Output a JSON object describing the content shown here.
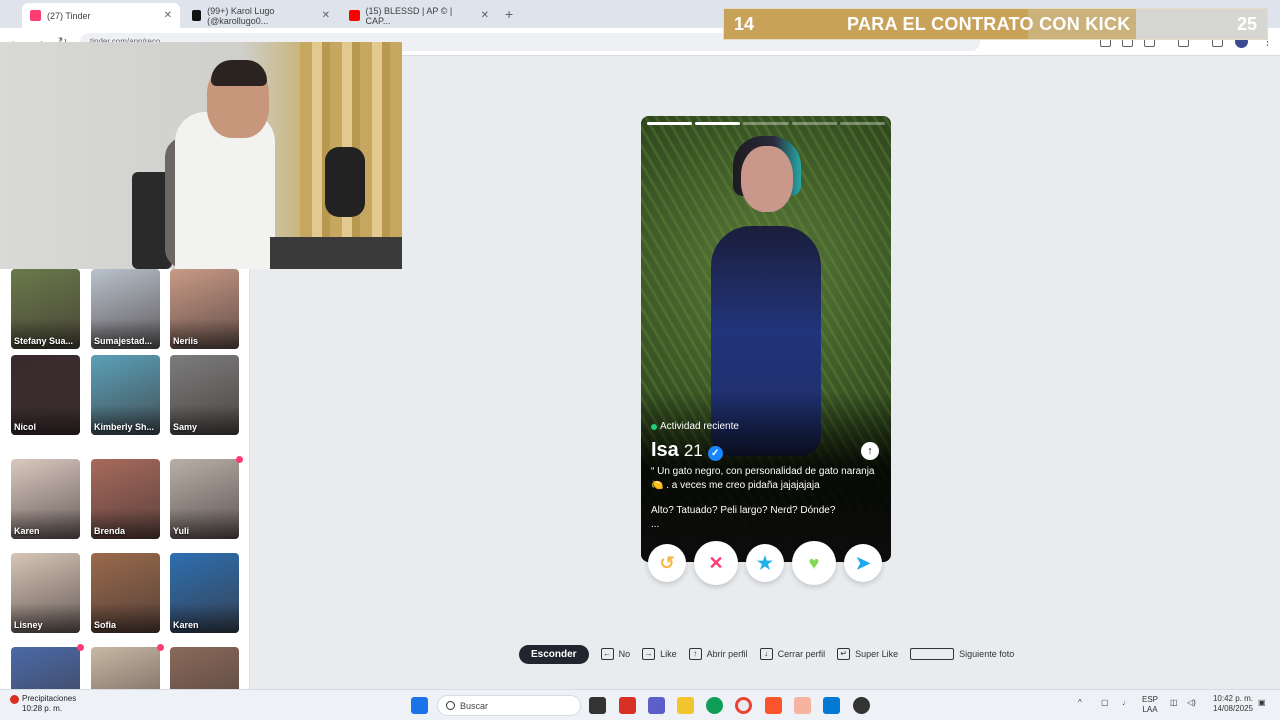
{
  "browser": {
    "tabs": [
      {
        "label": "(27) Tinder",
        "color": "#fe3c72",
        "active": true
      },
      {
        "label": "(99+) Karol Lugo (@karollugo0...",
        "color": "#111111",
        "active": false
      },
      {
        "label": "(15) BLESSD | AP © | CAP...",
        "color": "#ff0000",
        "active": false
      }
    ],
    "new_tab": "+",
    "url": "tinder.com/app/reco"
  },
  "banner": {
    "left_count": "14",
    "text": "PARA EL CONTRATO CON KICK",
    "right_count": "25",
    "progress": 0.56
  },
  "matches": [
    {
      "name": "Stefany Sua...",
      "color": "#6a7a4a",
      "dot": false
    },
    {
      "name": "Sumajestad...",
      "color": "#b9c2cc",
      "dot": false
    },
    {
      "name": "Neriis",
      "color": "#c99a86",
      "dot": false
    },
    {
      "name": "Nicol",
      "color": "#3a2a2e",
      "dot": false
    },
    {
      "name": "Kimberly Sh...",
      "color": "#5aa0b8",
      "dot": false
    },
    {
      "name": "Samy",
      "color": "#7c7c7c",
      "dot": false
    },
    {
      "name": "Karen",
      "color": "#d9c9c0",
      "dot": false
    },
    {
      "name": "Brenda",
      "color": "#a86a5c",
      "dot": false
    },
    {
      "name": "Yuli",
      "color": "#b8b0a8",
      "dot": true
    },
    {
      "name": "Lisney",
      "color": "#d6c6b8",
      "dot": false
    },
    {
      "name": "Sofia",
      "color": "#9a6a4c",
      "dot": false
    },
    {
      "name": "Karen",
      "color": "#2c6fb0",
      "dot": false
    },
    {
      "name": "",
      "color": "#4a6aa8",
      "dot": true
    },
    {
      "name": "",
      "color": "#c8b8a4",
      "dot": true
    },
    {
      "name": "",
      "color": "#8a6a5a",
      "dot": false
    }
  ],
  "profile": {
    "activity": "Actividad reciente",
    "name": "Isa",
    "age": "21",
    "verified_icon": "verified-badge-icon",
    "bio_line1": "“ Un gato negro, con personalidad de gato naranja 🍋 . a veces me creo pidaña jajajajaja",
    "bio_line2": "Alto? Tatuado? Peli largo? Nerd? Dónde?",
    "more": "...",
    "photos_total": 5,
    "photo_current": 2
  },
  "actions": {
    "rewind": "↺",
    "nope": "✕",
    "super_like": "★",
    "like": "♥",
    "boost": "➤",
    "colors": {
      "rewind": "#f5b748",
      "nope": "#fe3c72",
      "super_like": "#1fb2ee",
      "like": "#7ed957",
      "boost": "#1fa7ee"
    }
  },
  "shortcuts": {
    "hide": "Esconder",
    "items": [
      {
        "key": "←",
        "label": "No"
      },
      {
        "key": "→",
        "label": "Like"
      },
      {
        "key": "↑",
        "label": "Abrir perfil"
      },
      {
        "key": "↓",
        "label": "Cerrar perfil"
      },
      {
        "key": "↵",
        "label": "Super Like"
      },
      {
        "key": "",
        "label": "Siguiente foto"
      }
    ]
  },
  "taskbar": {
    "weather_title": "Precipitaciones",
    "weather_time": "10:28 p. m.",
    "search": "Buscar",
    "lang_top": "ESP",
    "lang_bottom": "LAA",
    "time": "10:42 p. m.",
    "date": "14/08/2025"
  }
}
